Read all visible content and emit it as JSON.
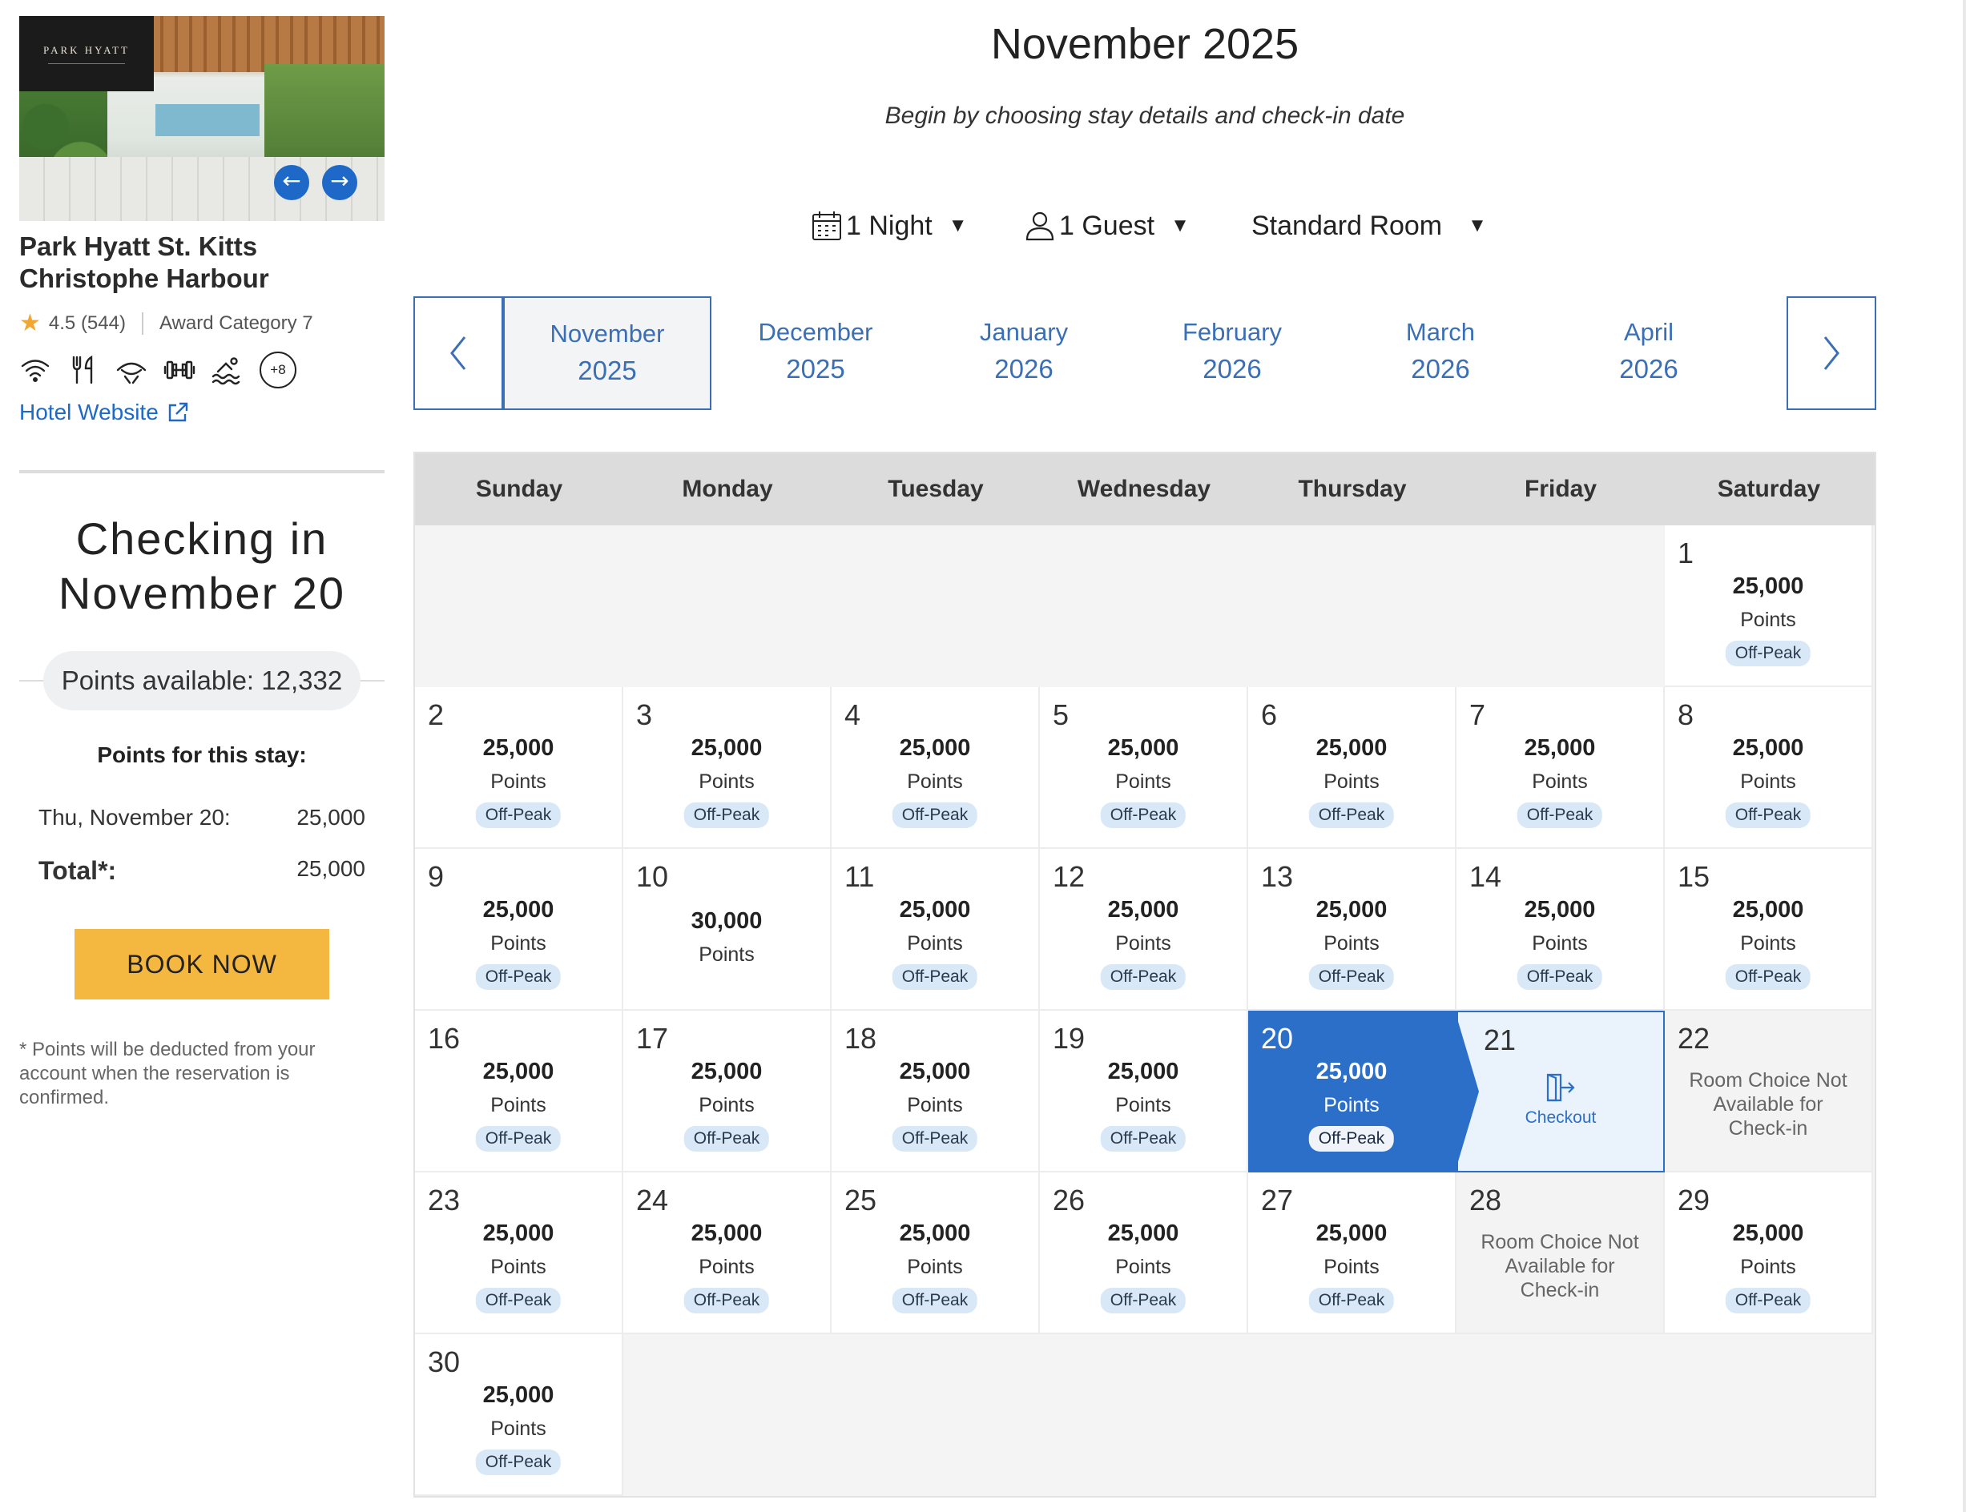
{
  "hotel": {
    "logo_text": "PARK HYATT",
    "name_line1": "Park Hyatt St. Kitts",
    "name_line2": "Christophe Harbour",
    "rating": "4.5 (544)",
    "award_category": "Award Category 7",
    "amenities": [
      "wifi-icon",
      "dining-icon",
      "spa-icon",
      "fitness-icon",
      "pool-icon"
    ],
    "amenities_more": "+8",
    "website_label": "Hotel Website"
  },
  "stay": {
    "checking_in_line1": "Checking in",
    "checking_in_line2": "November 20",
    "points_available": "Points available: 12,332",
    "points_title": "Points for this stay:",
    "night_label": "Thu, November 20:",
    "night_points": "25,000",
    "total_label": "Total*:",
    "total_points": "25,000",
    "book_label": "BOOK NOW",
    "footnote": "* Points will be deducted from your account when the reservation is confirmed."
  },
  "header": {
    "title": "November 2025",
    "subtitle": "Begin by choosing stay details and check-in date"
  },
  "filters": {
    "nights": "1 Night",
    "guests": "1 Guest",
    "room": "Standard Room"
  },
  "months": [
    {
      "name": "November",
      "year": "2025",
      "selected": true
    },
    {
      "name": "December",
      "year": "2025",
      "selected": false
    },
    {
      "name": "January",
      "year": "2026",
      "selected": false
    },
    {
      "name": "February",
      "year": "2026",
      "selected": false
    },
    {
      "name": "March",
      "year": "2026",
      "selected": false
    },
    {
      "name": "April",
      "year": "2026",
      "selected": false
    }
  ],
  "calendar": {
    "weekdays": [
      "Sunday",
      "Monday",
      "Tuesday",
      "Wednesday",
      "Thursday",
      "Friday",
      "Saturday"
    ],
    "leading_blanks": 6,
    "unit_label": "Points",
    "badge_label": "Off-Peak",
    "unavailable_text": "Room Choice Not Available for Check-in",
    "checkout_label": "Checkout",
    "days": [
      {
        "d": "1",
        "pts": "25,000",
        "offpeak": true
      },
      {
        "d": "2",
        "pts": "25,000",
        "offpeak": true
      },
      {
        "d": "3",
        "pts": "25,000",
        "offpeak": true
      },
      {
        "d": "4",
        "pts": "25,000",
        "offpeak": true
      },
      {
        "d": "5",
        "pts": "25,000",
        "offpeak": true
      },
      {
        "d": "6",
        "pts": "25,000",
        "offpeak": true
      },
      {
        "d": "7",
        "pts": "25,000",
        "offpeak": true
      },
      {
        "d": "8",
        "pts": "25,000",
        "offpeak": true
      },
      {
        "d": "9",
        "pts": "25,000",
        "offpeak": true
      },
      {
        "d": "10",
        "pts": "30,000",
        "offpeak": false
      },
      {
        "d": "11",
        "pts": "25,000",
        "offpeak": true
      },
      {
        "d": "12",
        "pts": "25,000",
        "offpeak": true
      },
      {
        "d": "13",
        "pts": "25,000",
        "offpeak": true
      },
      {
        "d": "14",
        "pts": "25,000",
        "offpeak": true
      },
      {
        "d": "15",
        "pts": "25,000",
        "offpeak": true
      },
      {
        "d": "16",
        "pts": "25,000",
        "offpeak": true
      },
      {
        "d": "17",
        "pts": "25,000",
        "offpeak": true
      },
      {
        "d": "18",
        "pts": "25,000",
        "offpeak": true
      },
      {
        "d": "19",
        "pts": "25,000",
        "offpeak": true
      },
      {
        "d": "20",
        "pts": "25,000",
        "offpeak": true,
        "state": "checkin"
      },
      {
        "d": "21",
        "state": "checkout"
      },
      {
        "d": "22",
        "state": "unavailable"
      },
      {
        "d": "23",
        "pts": "25,000",
        "offpeak": true
      },
      {
        "d": "24",
        "pts": "25,000",
        "offpeak": true
      },
      {
        "d": "25",
        "pts": "25,000",
        "offpeak": true
      },
      {
        "d": "26",
        "pts": "25,000",
        "offpeak": true
      },
      {
        "d": "27",
        "pts": "25,000",
        "offpeak": true
      },
      {
        "d": "28",
        "state": "unavailable"
      },
      {
        "d": "29",
        "pts": "25,000",
        "offpeak": true
      },
      {
        "d": "30",
        "pts": "25,000",
        "offpeak": true
      }
    ]
  }
}
